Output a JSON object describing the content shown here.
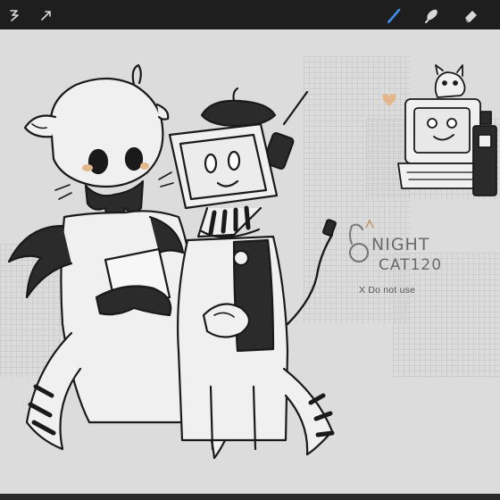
{
  "toolbar": {
    "left_tools": [
      {
        "name": "adjustments",
        "icon": "adjustments-icon"
      },
      {
        "name": "selection",
        "icon": "selection-arrow-icon"
      }
    ],
    "right_tools": [
      {
        "name": "brush",
        "icon": "brush-icon",
        "active": true
      },
      {
        "name": "smudge",
        "icon": "smudge-icon",
        "active": false
      },
      {
        "name": "eraser",
        "icon": "eraser-icon",
        "active": false
      }
    ],
    "active_color": "#3a8ee6"
  },
  "canvas": {
    "background": "#dcdcdc",
    "watermark": {
      "logo_text_line1": "NIGHT",
      "logo_text_line2": "CAT120",
      "notice": "X Do not use"
    }
  }
}
